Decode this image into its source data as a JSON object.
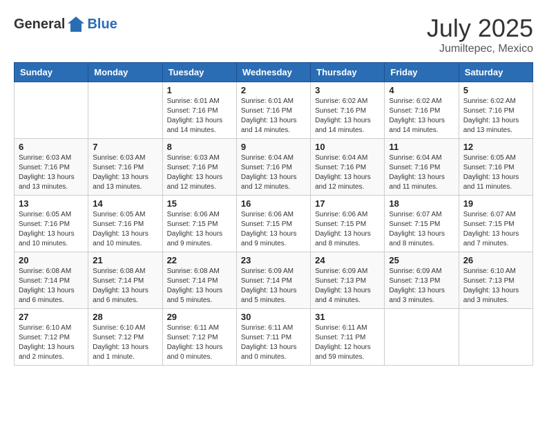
{
  "logo": {
    "general": "General",
    "blue": "Blue"
  },
  "title": {
    "month": "July 2025",
    "location": "Jumiltepec, Mexico"
  },
  "weekdays": [
    "Sunday",
    "Monday",
    "Tuesday",
    "Wednesday",
    "Thursday",
    "Friday",
    "Saturday"
  ],
  "weeks": [
    [
      {
        "day": "",
        "info": ""
      },
      {
        "day": "",
        "info": ""
      },
      {
        "day": "1",
        "info": "Sunrise: 6:01 AM\nSunset: 7:16 PM\nDaylight: 13 hours\nand 14 minutes."
      },
      {
        "day": "2",
        "info": "Sunrise: 6:01 AM\nSunset: 7:16 PM\nDaylight: 13 hours\nand 14 minutes."
      },
      {
        "day": "3",
        "info": "Sunrise: 6:02 AM\nSunset: 7:16 PM\nDaylight: 13 hours\nand 14 minutes."
      },
      {
        "day": "4",
        "info": "Sunrise: 6:02 AM\nSunset: 7:16 PM\nDaylight: 13 hours\nand 14 minutes."
      },
      {
        "day": "5",
        "info": "Sunrise: 6:02 AM\nSunset: 7:16 PM\nDaylight: 13 hours\nand 13 minutes."
      }
    ],
    [
      {
        "day": "6",
        "info": "Sunrise: 6:03 AM\nSunset: 7:16 PM\nDaylight: 13 hours\nand 13 minutes."
      },
      {
        "day": "7",
        "info": "Sunrise: 6:03 AM\nSunset: 7:16 PM\nDaylight: 13 hours\nand 13 minutes."
      },
      {
        "day": "8",
        "info": "Sunrise: 6:03 AM\nSunset: 7:16 PM\nDaylight: 13 hours\nand 12 minutes."
      },
      {
        "day": "9",
        "info": "Sunrise: 6:04 AM\nSunset: 7:16 PM\nDaylight: 13 hours\nand 12 minutes."
      },
      {
        "day": "10",
        "info": "Sunrise: 6:04 AM\nSunset: 7:16 PM\nDaylight: 13 hours\nand 12 minutes."
      },
      {
        "day": "11",
        "info": "Sunrise: 6:04 AM\nSunset: 7:16 PM\nDaylight: 13 hours\nand 11 minutes."
      },
      {
        "day": "12",
        "info": "Sunrise: 6:05 AM\nSunset: 7:16 PM\nDaylight: 13 hours\nand 11 minutes."
      }
    ],
    [
      {
        "day": "13",
        "info": "Sunrise: 6:05 AM\nSunset: 7:16 PM\nDaylight: 13 hours\nand 10 minutes."
      },
      {
        "day": "14",
        "info": "Sunrise: 6:05 AM\nSunset: 7:16 PM\nDaylight: 13 hours\nand 10 minutes."
      },
      {
        "day": "15",
        "info": "Sunrise: 6:06 AM\nSunset: 7:15 PM\nDaylight: 13 hours\nand 9 minutes."
      },
      {
        "day": "16",
        "info": "Sunrise: 6:06 AM\nSunset: 7:15 PM\nDaylight: 13 hours\nand 9 minutes."
      },
      {
        "day": "17",
        "info": "Sunrise: 6:06 AM\nSunset: 7:15 PM\nDaylight: 13 hours\nand 8 minutes."
      },
      {
        "day": "18",
        "info": "Sunrise: 6:07 AM\nSunset: 7:15 PM\nDaylight: 13 hours\nand 8 minutes."
      },
      {
        "day": "19",
        "info": "Sunrise: 6:07 AM\nSunset: 7:15 PM\nDaylight: 13 hours\nand 7 minutes."
      }
    ],
    [
      {
        "day": "20",
        "info": "Sunrise: 6:08 AM\nSunset: 7:14 PM\nDaylight: 13 hours\nand 6 minutes."
      },
      {
        "day": "21",
        "info": "Sunrise: 6:08 AM\nSunset: 7:14 PM\nDaylight: 13 hours\nand 6 minutes."
      },
      {
        "day": "22",
        "info": "Sunrise: 6:08 AM\nSunset: 7:14 PM\nDaylight: 13 hours\nand 5 minutes."
      },
      {
        "day": "23",
        "info": "Sunrise: 6:09 AM\nSunset: 7:14 PM\nDaylight: 13 hours\nand 5 minutes."
      },
      {
        "day": "24",
        "info": "Sunrise: 6:09 AM\nSunset: 7:13 PM\nDaylight: 13 hours\nand 4 minutes."
      },
      {
        "day": "25",
        "info": "Sunrise: 6:09 AM\nSunset: 7:13 PM\nDaylight: 13 hours\nand 3 minutes."
      },
      {
        "day": "26",
        "info": "Sunrise: 6:10 AM\nSunset: 7:13 PM\nDaylight: 13 hours\nand 3 minutes."
      }
    ],
    [
      {
        "day": "27",
        "info": "Sunrise: 6:10 AM\nSunset: 7:12 PM\nDaylight: 13 hours\nand 2 minutes."
      },
      {
        "day": "28",
        "info": "Sunrise: 6:10 AM\nSunset: 7:12 PM\nDaylight: 13 hours\nand 1 minute."
      },
      {
        "day": "29",
        "info": "Sunrise: 6:11 AM\nSunset: 7:12 PM\nDaylight: 13 hours\nand 0 minutes."
      },
      {
        "day": "30",
        "info": "Sunrise: 6:11 AM\nSunset: 7:11 PM\nDaylight: 13 hours\nand 0 minutes."
      },
      {
        "day": "31",
        "info": "Sunrise: 6:11 AM\nSunset: 7:11 PM\nDaylight: 12 hours\nand 59 minutes."
      },
      {
        "day": "",
        "info": ""
      },
      {
        "day": "",
        "info": ""
      }
    ]
  ]
}
